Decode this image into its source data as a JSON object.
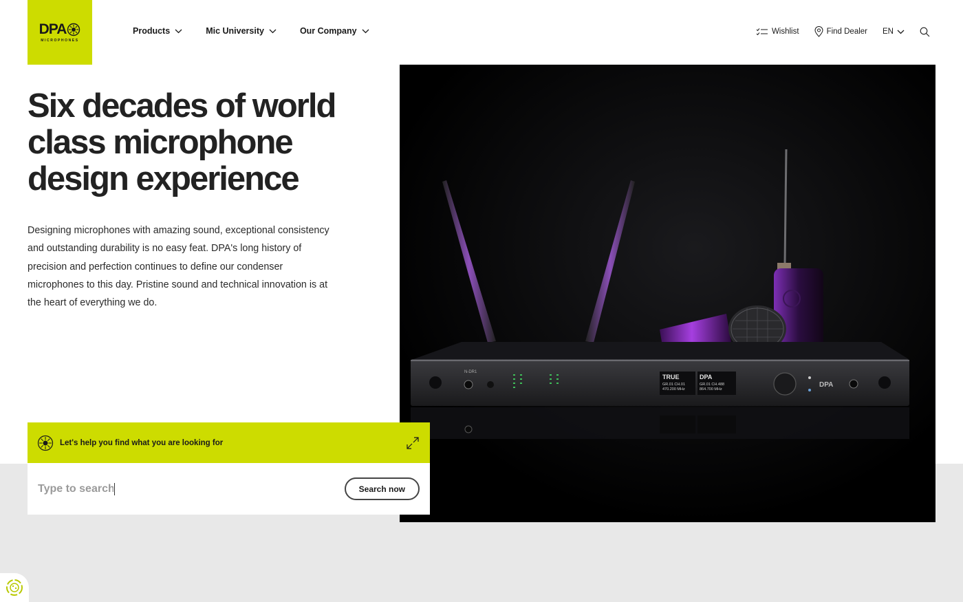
{
  "brand": {
    "logo_text": "DPA",
    "logo_subtext": "MICROPHONES",
    "accent": "#cddc00"
  },
  "nav": {
    "items": [
      {
        "label": "Products"
      },
      {
        "label": "Mic University"
      },
      {
        "label": "Our Company"
      }
    ]
  },
  "utility": {
    "wishlist": "Wishlist",
    "find_dealer": "Find Dealer",
    "language": "EN"
  },
  "hero": {
    "title": "Six decades of world class microphone design experience",
    "body": "Designing microphones with amazing sound, exceptional consistency and outstanding durability is no easy feat. DPA's long history of precision and perfection continues to define our condenser microphones to this day. Pristine sound and technical innovation is at the heart of everything we do.",
    "image_alt": "DPA wireless receiver with handheld and bodypack transmitters"
  },
  "device": {
    "display_left_title": "TRUE",
    "display_left_l1": "GR.01  CH.01",
    "display_left_l2": "470.200 MHz",
    "display_right_title": "DPA",
    "display_right_l1": "GR.01  CH.488",
    "display_right_l2": "864.700 MHz",
    "front_brand": "DPA",
    "model": "N-DR1"
  },
  "search": {
    "heading": "Let's help you find what you are looking for",
    "placeholder": "Type to search",
    "button": "Search now"
  }
}
